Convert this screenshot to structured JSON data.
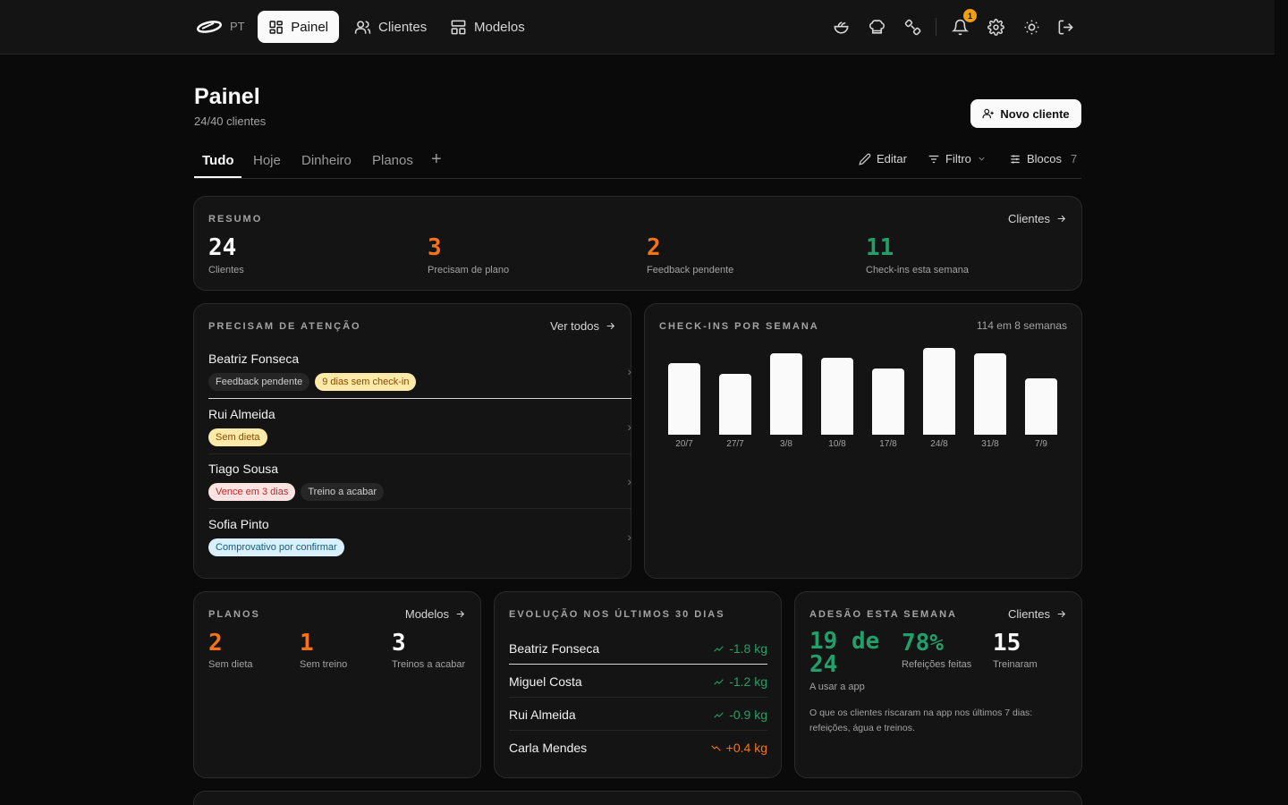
{
  "topbar": {
    "lang": "PT",
    "nav": [
      {
        "label": "Painel",
        "active": true
      },
      {
        "label": "Clientes",
        "active": false
      },
      {
        "label": "Modelos",
        "active": false
      }
    ],
    "icons": [
      "food-icon",
      "chef-hat-icon",
      "dumbbell-icon",
      "bell-icon",
      "gear-icon",
      "sun-icon",
      "logout-icon"
    ],
    "notification_count": "1"
  },
  "header": {
    "title": "Painel",
    "subtitle": "24/40 clientes",
    "new_client_label": "Novo cliente"
  },
  "tabs": {
    "items": [
      "Tudo",
      "Hoje",
      "Dinheiro",
      "Planos"
    ],
    "active": "Tudo",
    "edit_label": "Editar",
    "filter_label": "Filtro",
    "blocks_label": "Blocos",
    "blocks_count": "7"
  },
  "summary": {
    "label": "RESUMO",
    "link": "Clientes",
    "stats": [
      {
        "value": "24",
        "label": "Clientes",
        "color": "#fafafa"
      },
      {
        "value": "3",
        "label": "Precisam de plano",
        "color": "#f97316"
      },
      {
        "value": "2",
        "label": "Feedback pendente",
        "color": "#f97316"
      },
      {
        "value": "11",
        "label": "Check-ins esta semana",
        "color": "#22a06b"
      }
    ]
  },
  "attention": {
    "label": "PRECISAM DE ATENÇÃO",
    "link": "Ver todos",
    "rows": [
      {
        "name": "Beatriz Fonseca",
        "tags": [
          {
            "text": "Feedback pendente",
            "kind": "gray"
          },
          {
            "text": "9 dias sem check-in",
            "kind": "yellow"
          }
        ]
      },
      {
        "name": "Rui Almeida",
        "tags": [
          {
            "text": "Sem dieta",
            "kind": "yellow"
          }
        ]
      },
      {
        "name": "Tiago Sousa",
        "tags": [
          {
            "text": "Vence em 3 dias",
            "kind": "red"
          },
          {
            "text": "Treino a acabar",
            "kind": "gray"
          }
        ]
      },
      {
        "name": "Sofia Pinto",
        "tags": [
          {
            "text": "Comprovativo por confirmar",
            "kind": "blue"
          }
        ]
      }
    ]
  },
  "checkins": {
    "label": "CHECK-INS POR SEMANA",
    "summary": "114 em 8 semanas"
  },
  "chart_data": {
    "type": "bar",
    "title": "CHECK-INS POR SEMANA",
    "categories": [
      "20/7",
      "27/7",
      "3/8",
      "10/8",
      "17/8",
      "24/8",
      "31/8",
      "7/9"
    ],
    "values": [
      14,
      12,
      16,
      15,
      13,
      17,
      16,
      11
    ],
    "ylim": [
      0,
      17
    ],
    "grid": false
  },
  "plans": {
    "label": "PLANOS",
    "link": "Modelos",
    "stats": [
      {
        "value": "2",
        "label": "Sem dieta",
        "color": "#f97316"
      },
      {
        "value": "1",
        "label": "Sem treino",
        "color": "#f97316"
      },
      {
        "value": "3",
        "label": "Treinos a acabar",
        "color": "#fafafa"
      }
    ]
  },
  "evolution": {
    "label": "EVOLUÇÃO NOS ÚLTIMOS 30 DIAS",
    "rows": [
      {
        "name": "Beatriz Fonseca",
        "value": "-1.8 kg",
        "trend": "down",
        "color": "#22a06b"
      },
      {
        "name": "Miguel Costa",
        "value": "-1.2 kg",
        "trend": "down",
        "color": "#22a06b"
      },
      {
        "name": "Rui Almeida",
        "value": "-0.9 kg",
        "trend": "down",
        "color": "#22a06b"
      },
      {
        "name": "Carla Mendes",
        "value": "+0.4 kg",
        "trend": "up",
        "color": "#f97316"
      }
    ]
  },
  "adherence": {
    "label": "ADESÃO ESTA SEMANA",
    "link": "Clientes",
    "app_value": "19 de 24",
    "app_label": "A usar a app",
    "meals_value": "78%",
    "meals_label": "Refeições feitas",
    "trained_value": "15",
    "trained_label": "Treinaram",
    "note": "O que os clientes riscaram na app nos últimos 7 dias: refeições, água e treinos.",
    "colors": {
      "green": "#22a06b",
      "white": "#fafafa"
    }
  }
}
